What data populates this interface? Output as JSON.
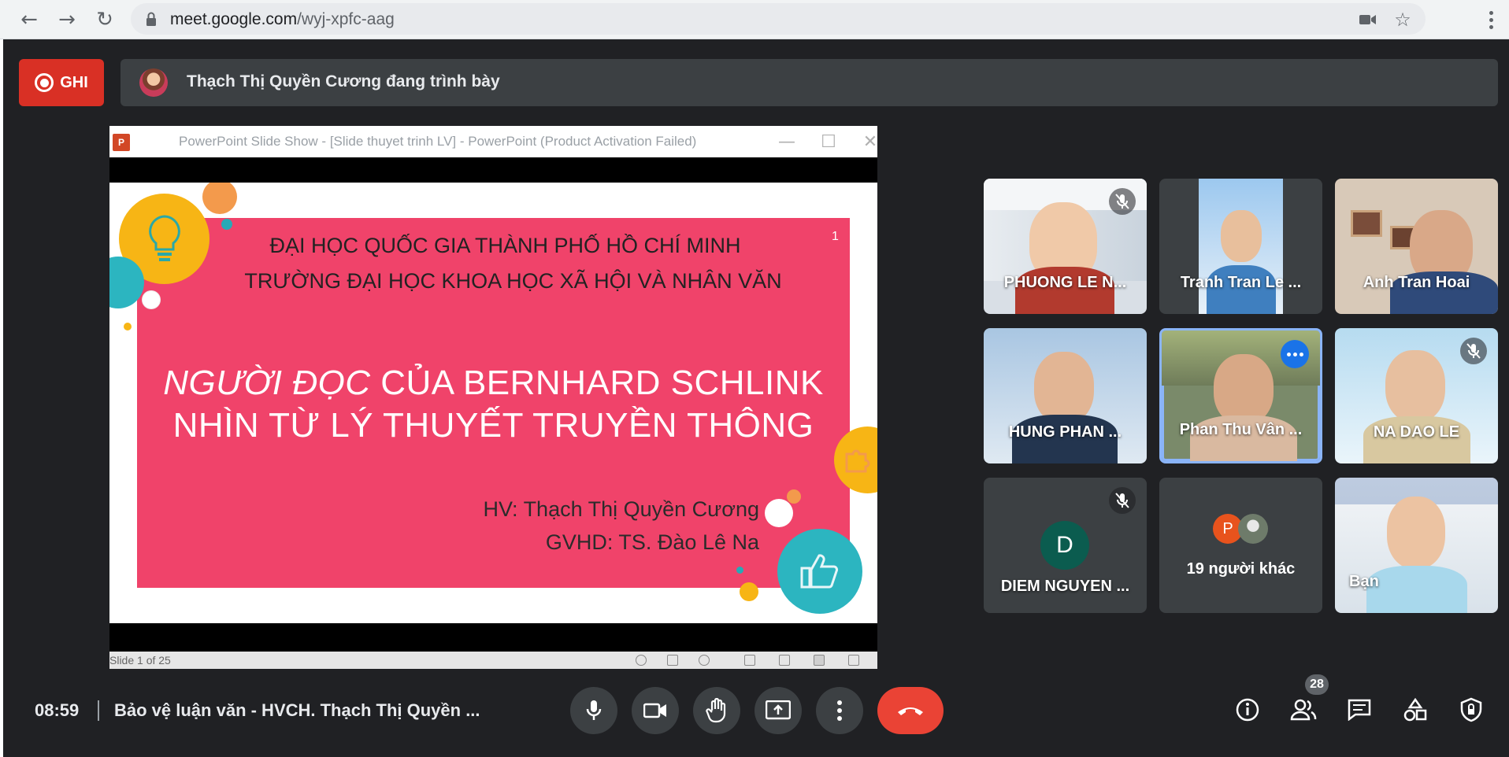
{
  "browser": {
    "url_host": "meet.google.com",
    "url_path": "/wyj-xpfc-aag",
    "back_icon": "arrow-left-icon",
    "forward_icon": "arrow-right-icon",
    "reload_icon": "reload-icon"
  },
  "meet": {
    "record_label": "GHI",
    "presenter_text": "Thạch Thị Quyền Cương đang trình bày",
    "time": "08:59",
    "meeting_name": "Bảo vệ luận văn - HVCH. Thạch Thị Quyền ...",
    "participants_count": "28"
  },
  "ppt": {
    "window_title": "PowerPoint Slide Show - [Slide thuyet trinh LV] - PowerPoint (Product Activation Failed)",
    "status": "Slide 1 of 25"
  },
  "slide": {
    "number": "1",
    "university": "ĐẠI HỌC QUỐC GIA THÀNH PHỐ HỒ CHÍ MINH",
    "school": "TRƯỜNG ĐẠI HỌC KHOA HỌC XÃ HỘI VÀ NHÂN VĂN",
    "title_italic": "NGƯỜI ĐỌC",
    "title_rest": " CỦA BERNHARD SCHLINK",
    "title_line2": "NHÌN TỪ LÝ THUYẾT TRUYỀN THÔNG",
    "student": "HV: Thạch Thị Quyền Cương",
    "advisor": "GVHD: TS. Đào Lê Na"
  },
  "tiles": [
    {
      "name": "PHUONG LE N..."
    },
    {
      "name": "Tranh Tran Le ..."
    },
    {
      "name": "Anh Tran Hoai"
    },
    {
      "name": "HUNG PHAN ..."
    },
    {
      "name": "Phan Thu Vân ..."
    },
    {
      "name": "NA DAO LE"
    },
    {
      "name": "DIEM NGUYEN ...",
      "initial": "D"
    },
    {
      "name": "19 người khác",
      "initial": "P"
    },
    {
      "name": "Bạn"
    }
  ],
  "colors": {
    "record": "#d93025",
    "slide_pink": "#f0436a",
    "end_call": "#ea4335",
    "active_tile": "#8ab4f8"
  }
}
